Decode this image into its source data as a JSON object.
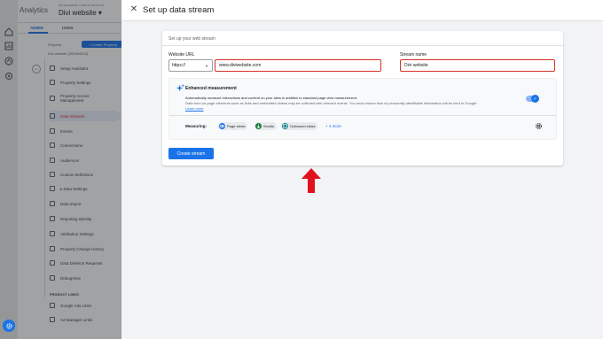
{
  "app": {
    "name": "Analytics",
    "breadcrumb": "All accounts › Demo account",
    "account": "Divi website ▾"
  },
  "admin": {
    "tabs": [
      "ADMIN",
      "USER"
    ],
    "property_label": "Property",
    "create_property": "+ Create Property",
    "property_name": "Divi website (303484022)",
    "menu": [
      "Setup Assistant",
      "Property Settings",
      "Property Access Management",
      "Data Streams",
      "Events",
      "Conversions",
      "Audiences",
      "Custom definitions",
      "▸ Data Settings",
      "Data Import",
      "Reporting Identity",
      "Attribution Settings",
      "Property Change History",
      "Data Deletion Requests",
      "DebugView"
    ],
    "product_links_heading": "PRODUCT LINKS",
    "product_links": [
      "Google Ads Links",
      "Ad Manager Links"
    ]
  },
  "drawer": {
    "title": "Set up data stream",
    "card_title": "Set up your web stream",
    "website_url_label": "Website URL",
    "protocol": "https://",
    "url_value": "www.diviwebsite.com",
    "stream_name_label": "Stream name",
    "stream_name_value": "Divi website",
    "enhanced": {
      "title": "Enhanced measurement",
      "desc1": "Automatically measure interactions and content on your sites in addition to standard page view measurement.",
      "desc2": "Data from on-page elements such as links and embedded videos may be collected with relevant events. You must ensure that no personally-identifiable information will be sent to Google.",
      "learn_more": "Learn more",
      "enabled": true,
      "measuring_label": "Measuring:",
      "chips": [
        "Page views",
        "Scrolls",
        "Outbound clicks"
      ],
      "more": "+ 4 more"
    },
    "create_button": "Create stream"
  },
  "colors": {
    "accent": "#1a73e8",
    "highlight": "#d93025",
    "chip_page_views": "#1a73e8",
    "chip_scrolls": "#188038",
    "chip_outbound": "#12808f"
  }
}
